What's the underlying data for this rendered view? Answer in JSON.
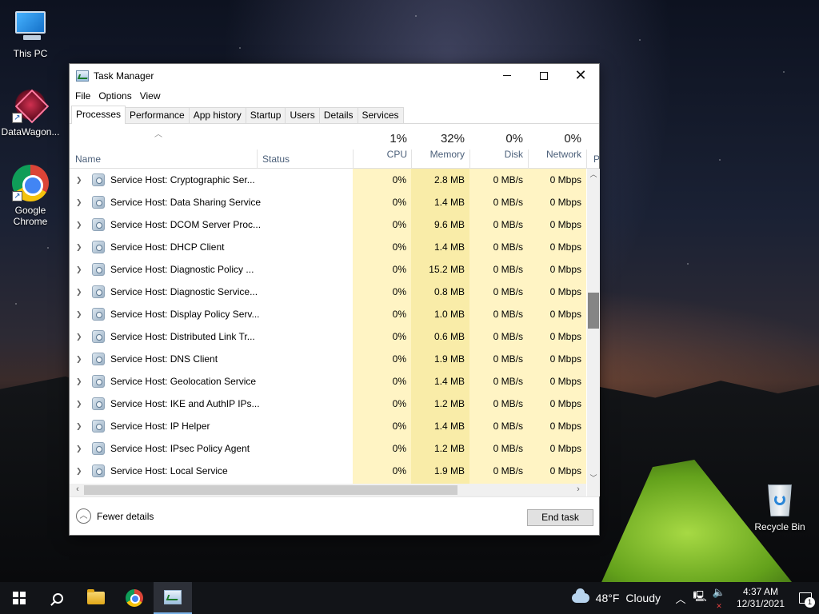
{
  "desktop": {
    "icons": [
      {
        "label": "This PC"
      },
      {
        "label": "DataWagon..."
      },
      {
        "label": "Google Chrome"
      },
      {
        "label": "Recycle Bin"
      }
    ]
  },
  "window": {
    "title": "Task Manager",
    "menu": [
      "File",
      "Options",
      "View"
    ],
    "tabs": [
      "Processes",
      "Performance",
      "App history",
      "Startup",
      "Users",
      "Details",
      "Services"
    ],
    "active_tab": "Processes"
  },
  "columns": {
    "name": "Name",
    "status": "Status",
    "cpu": {
      "pct": "1%",
      "label": "CPU"
    },
    "memory": {
      "pct": "32%",
      "label": "Memory"
    },
    "disk": {
      "pct": "0%",
      "label": "Disk"
    },
    "network": {
      "pct": "0%",
      "label": "Network"
    },
    "power_truncated": "P"
  },
  "processes": [
    {
      "name": "Service Host: Cryptographic Ser...",
      "cpu": "0%",
      "memory": "2.8 MB",
      "disk": "0 MB/s",
      "network": "0 Mbps"
    },
    {
      "name": "Service Host: Data Sharing Service",
      "cpu": "0%",
      "memory": "1.4 MB",
      "disk": "0 MB/s",
      "network": "0 Mbps"
    },
    {
      "name": "Service Host: DCOM Server Proc...",
      "cpu": "0%",
      "memory": "9.6 MB",
      "disk": "0 MB/s",
      "network": "0 Mbps"
    },
    {
      "name": "Service Host: DHCP Client",
      "cpu": "0%",
      "memory": "1.4 MB",
      "disk": "0 MB/s",
      "network": "0 Mbps"
    },
    {
      "name": "Service Host: Diagnostic Policy ...",
      "cpu": "0%",
      "memory": "15.2 MB",
      "disk": "0 MB/s",
      "network": "0 Mbps"
    },
    {
      "name": "Service Host: Diagnostic Service...",
      "cpu": "0%",
      "memory": "0.8 MB",
      "disk": "0 MB/s",
      "network": "0 Mbps"
    },
    {
      "name": "Service Host: Display Policy Serv...",
      "cpu": "0%",
      "memory": "1.0 MB",
      "disk": "0 MB/s",
      "network": "0 Mbps"
    },
    {
      "name": "Service Host: Distributed Link Tr...",
      "cpu": "0%",
      "memory": "0.6 MB",
      "disk": "0 MB/s",
      "network": "0 Mbps"
    },
    {
      "name": "Service Host: DNS Client",
      "cpu": "0%",
      "memory": "1.9 MB",
      "disk": "0 MB/s",
      "network": "0 Mbps"
    },
    {
      "name": "Service Host: Geolocation Service",
      "cpu": "0%",
      "memory": "1.4 MB",
      "disk": "0 MB/s",
      "network": "0 Mbps"
    },
    {
      "name": "Service Host: IKE and AuthIP IPs...",
      "cpu": "0%",
      "memory": "1.2 MB",
      "disk": "0 MB/s",
      "network": "0 Mbps"
    },
    {
      "name": "Service Host: IP Helper",
      "cpu": "0%",
      "memory": "1.4 MB",
      "disk": "0 MB/s",
      "network": "0 Mbps"
    },
    {
      "name": "Service Host: IPsec Policy Agent",
      "cpu": "0%",
      "memory": "1.2 MB",
      "disk": "0 MB/s",
      "network": "0 Mbps"
    },
    {
      "name": "Service Host: Local Service",
      "cpu": "0%",
      "memory": "1.9 MB",
      "disk": "0 MB/s",
      "network": "0 Mbps"
    }
  ],
  "footer": {
    "fewer_details": "Fewer details",
    "end_task": "End task"
  },
  "taskbar": {
    "weather_temp": "48°F",
    "weather_desc": "Cloudy",
    "time": "4:37 AM",
    "date": "12/31/2021",
    "notification_count": "1"
  },
  "colors": {
    "heat_cell": "#fff4c4",
    "heat_cell_strong": "#f9eca8",
    "accent": "#0078d7"
  }
}
